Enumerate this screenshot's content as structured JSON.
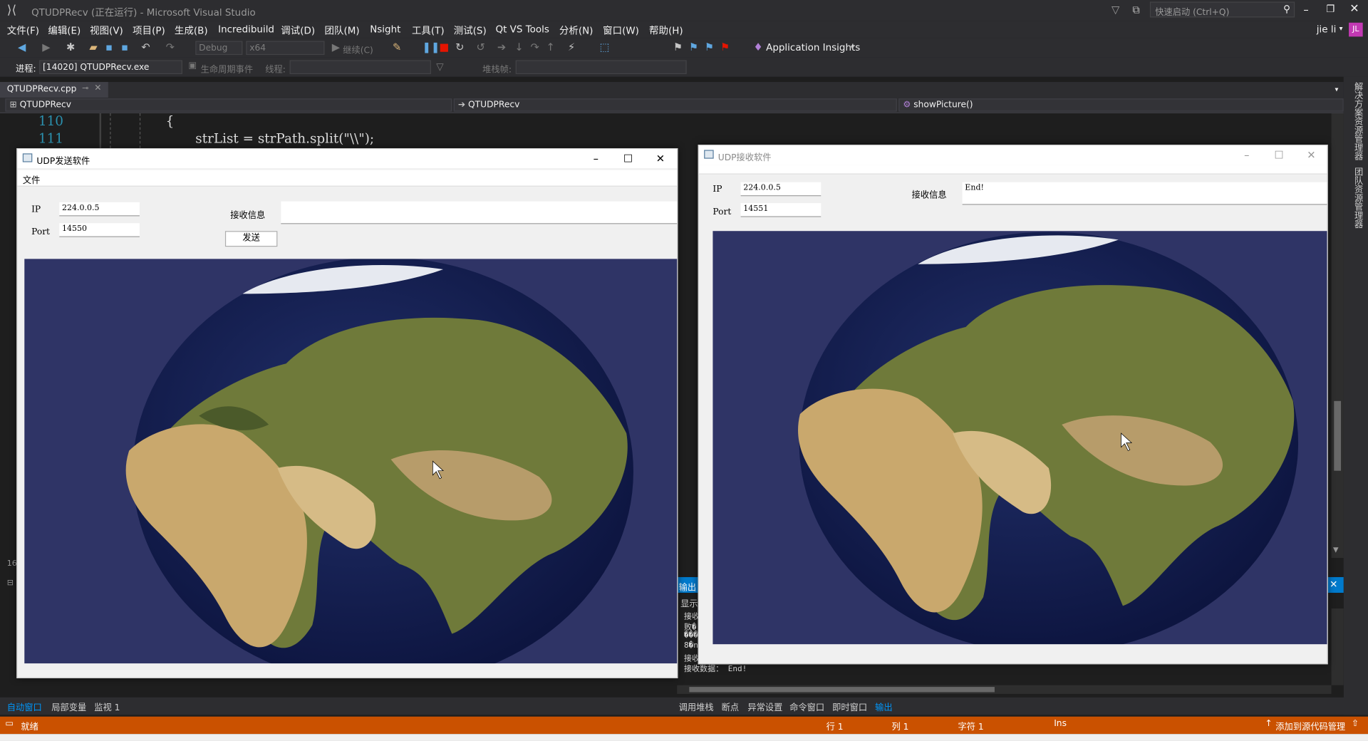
{
  "vs": {
    "title": "QTUDPRecv (正在运行) - Microsoft Visual Studio",
    "quick_launch_placeholder": "快速启动 (Ctrl+Q)",
    "user_name": "jie li",
    "user_initials": "JL",
    "menu": [
      "文件(F)",
      "编辑(E)",
      "视图(V)",
      "项目(P)",
      "生成(B)",
      "Incredibuild",
      "调试(D)",
      "团队(M)",
      "Nsight",
      "工具(T)",
      "测试(S)",
      "Qt VS Tools",
      "分析(N)",
      "窗口(W)",
      "帮助(H)"
    ],
    "toolbar": {
      "config": "Debug",
      "platform": "x64",
      "continue_label": "继续(C)",
      "app_insights": "Application Insights"
    },
    "debug_bar": {
      "process_label": "进程:",
      "process_value": "[14020] QTUDPRecv.exe",
      "lifecycle_label": "生命周期事件",
      "thread_label": "线程:",
      "stack_label": "堆栈帧:"
    },
    "doc_tab": "QTUDPRecv.cpp",
    "nav": {
      "project": "QTUDPRecv",
      "scope": "QTUDPRecv",
      "member": "showPicture()"
    },
    "code": {
      "lines": [
        {
          "no": "110",
          "text": "{"
        },
        {
          "no": "111",
          "text": "strList = strPath.split(\"\\\\\");"
        }
      ]
    },
    "right_panels": [
      "解决方案资源管理器",
      "团队资源管理器"
    ],
    "gutter_number": "16",
    "output": {
      "header": "输出",
      "show_label": "显示",
      "lines": [
        "接收",
        "败�",
        "���",
        "8�n",
        "接收",
        "接收数据：  End!"
      ]
    },
    "bottom_tabs_left": [
      "自动窗口",
      "局部变量",
      "监视 1"
    ],
    "bottom_tabs_right": [
      "调用堆栈",
      "断点",
      "异常设置",
      "命令窗口",
      "即时窗口",
      "输出"
    ],
    "status": {
      "ready": "就绪",
      "row": "行 1",
      "col": "列 1",
      "char": "字符 1",
      "ins": "Ins",
      "source_control": "添加到源代码管理"
    }
  },
  "sender": {
    "title": "UDP发送软件",
    "menu_file": "文件",
    "ip_label": "IP",
    "ip_value": "224.0.0.5",
    "port_label": "Port",
    "port_value": "14550",
    "recv_label": "接收信息",
    "recv_value": "",
    "send_button": "发送"
  },
  "receiver": {
    "title": "UDP接收软件",
    "ip_label": "IP",
    "ip_value": "224.0.0.5",
    "port_label": "Port",
    "port_value": "14551",
    "recv_label": "接收信息",
    "recv_value": "End!"
  },
  "colors": {
    "vs_chrome": "#2d2d30",
    "vs_accent": "#007acc",
    "status_bar": "#ca5100",
    "picture_bg": "#2f3466"
  }
}
